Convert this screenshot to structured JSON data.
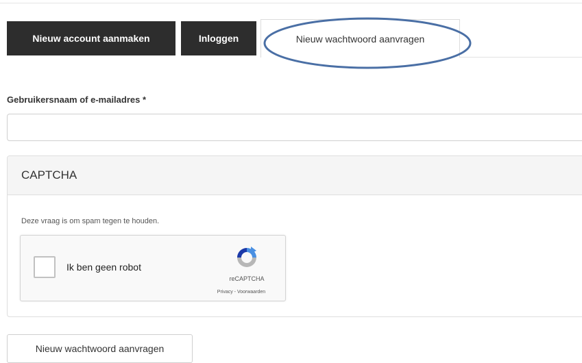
{
  "tabs": [
    {
      "label": "Nieuw account aanmaken",
      "active": false
    },
    {
      "label": "Inloggen",
      "active": false
    },
    {
      "label": "Nieuw wachtwoord aanvragen",
      "active": true
    }
  ],
  "form": {
    "username_label": "Gebruikersnaam of e-mailadres *",
    "username_value": "",
    "username_placeholder": ""
  },
  "captcha": {
    "title": "CAPTCHA",
    "description": "Deze vraag is om spam tegen te houden.",
    "checkbox_label": "Ik ben geen robot",
    "brand": "reCAPTCHA",
    "links": "Privacy - Voorwaarden",
    "logo_icon": "recaptcha-logo-icon"
  },
  "submit_label": "Nieuw wachtwoord aanvragen",
  "colors": {
    "dark_tab": "#2d2d2d",
    "annotation": "#4a6fa5",
    "recaptcha_blue": "#4a90e2",
    "recaptcha_grey": "#b7b7b7"
  }
}
